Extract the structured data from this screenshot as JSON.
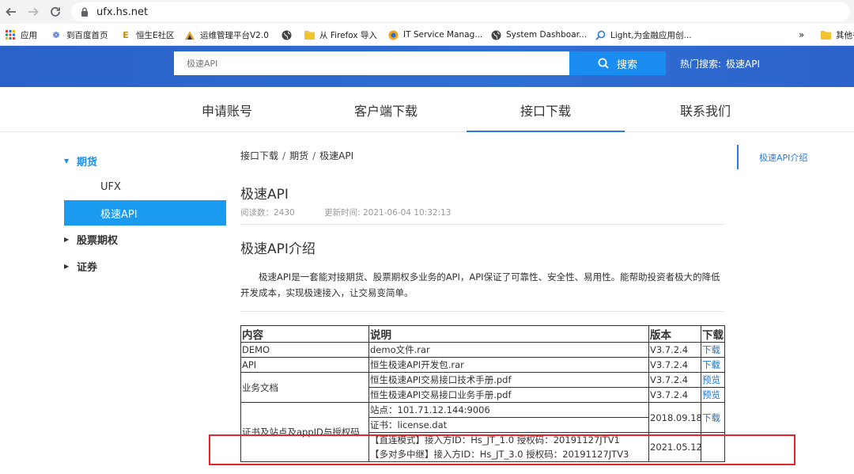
{
  "browser": {
    "url": "ufx.hs.net",
    "bookmarks": [
      {
        "label": "应用",
        "icon": "apps-grid-icon"
      },
      {
        "label": "到百度首页",
        "icon": "baidu-paw-icon"
      },
      {
        "label": "恒生E社区",
        "icon": "hundsun-e-icon"
      },
      {
        "label": "运维管理平台V2.0",
        "icon": "ops-platform-icon"
      },
      {
        "label": "",
        "icon": "globe-icon"
      },
      {
        "label": "从 Firefox 导入",
        "icon": "folder-icon"
      },
      {
        "label": "IT Service Manag...",
        "icon": "it-service-icon"
      },
      {
        "label": "System Dashboar...",
        "icon": "globe-icon"
      },
      {
        "label": "Light,为金融应用创...",
        "icon": "light-search-icon"
      },
      {
        "label": "»",
        "icon": ""
      },
      {
        "label": "其他书",
        "icon": "folder-icon"
      }
    ]
  },
  "header": {
    "search_placeholder": "极速API",
    "search_button": "搜索",
    "hot_label": "热门搜索:",
    "hot_link": "极速API",
    "accent": "#2a62c9"
  },
  "nav": {
    "items": [
      {
        "label": "申请账号"
      },
      {
        "label": "客户端下载"
      },
      {
        "label": "接口下载"
      },
      {
        "label": "联系我们"
      }
    ],
    "active": "接口下载"
  },
  "sidebar": {
    "groups": [
      {
        "label": "期货",
        "open": true,
        "children": [
          {
            "label": "UFX"
          },
          {
            "label": "极速API"
          }
        ]
      },
      {
        "label": "股票期权",
        "open": false
      },
      {
        "label": "证券",
        "open": false
      }
    ]
  },
  "article": {
    "breadcrumb": [
      "接口下载",
      "期货",
      "极速API"
    ],
    "title": "极速API",
    "read_count": "阅读数：2430",
    "updated": "更新时间: 2021-06-04 10:32:13",
    "section_title": "极速API介绍",
    "intro": "极速API是一套能对接期货、股票期权多业务的API，API保证了可靠性、安全性、易用性。能帮助投资者极大的降低开发成本，实现极速接入，让交易变简单。",
    "table": {
      "headers": [
        "内容",
        "说明",
        "版本",
        "下载"
      ],
      "rows": [
        {
          "content": "DEMO",
          "desc": "demo文件.rar",
          "version": "V3.7.2.4",
          "action": "下载"
        },
        {
          "content": "API",
          "desc": "恒生极速API开发包.rar",
          "version": "V3.7.2.4",
          "action": "下载"
        },
        {
          "content": "业务文档",
          "desc": "恒生极速API交易接口技术手册.pdf",
          "version": "V3.7.2.4",
          "action": "预览"
        },
        {
          "content": "",
          "desc": "恒生极速API交易接口业务手册.pdf",
          "version": "V3.7.2.4",
          "action": "预览"
        },
        {
          "content": "证书及站点及appID与授权码",
          "desc": "站点：101.71.12.144:9006",
          "version": "2018.09.18",
          "action": "下载"
        },
        {
          "content": "",
          "desc": "证书：license.dat",
          "version": "",
          "action": ""
        },
        {
          "content": "",
          "desc": "【直连模式】接入方ID：Hs_JT_1.0   授权码：20191127JTV1",
          "version": "2021.05.12",
          "action": ""
        },
        {
          "content": "",
          "desc": "【多对多中继】接入方ID：Hs_JT_3.0   授权码：20191127JTV3",
          "version": "",
          "action": ""
        }
      ]
    }
  },
  "toc": {
    "items": [
      {
        "label": "极速API介绍"
      }
    ]
  },
  "highlight_color": "#e3262b"
}
